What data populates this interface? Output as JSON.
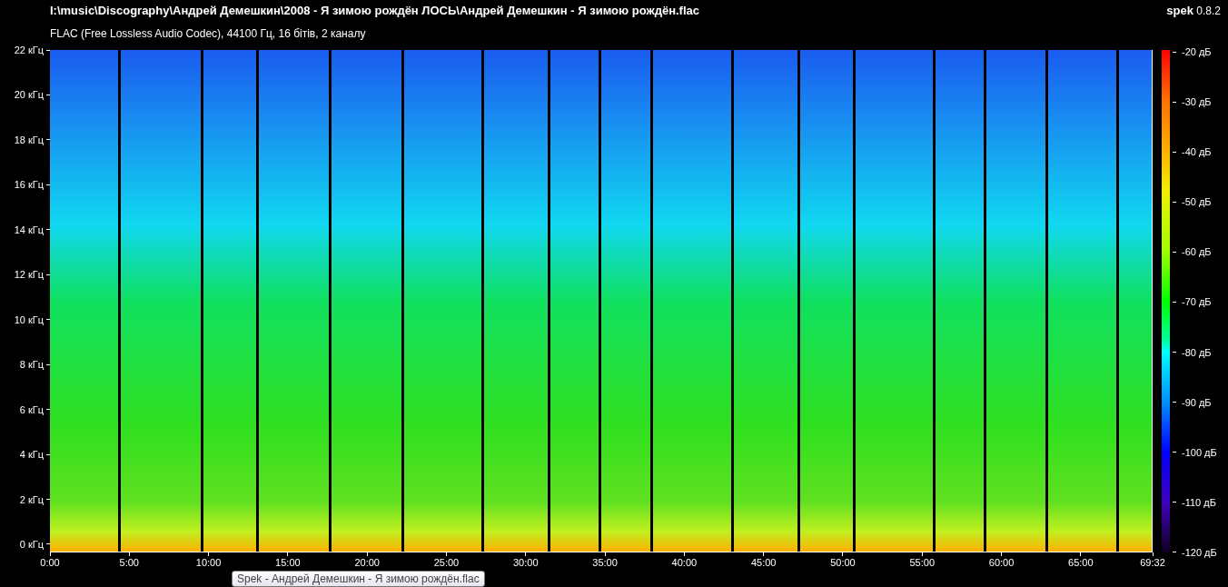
{
  "header": {
    "path": "I:\\music\\Discography\\Андрей Демешкин\\2008 - Я зимою рождён ЛОСЬ\\Андрей Демешкин - Я зимою рождён.flac",
    "format": "FLAC (Free Lossless Audio Codec), 44100 Гц, 16 бітів, 2 каналу",
    "app_name": "spek",
    "app_version": "0.8.2"
  },
  "frequency_axis": [
    "22 кГц",
    "20 кГц",
    "18 кГц",
    "16 кГц",
    "14 кГц",
    "12 кГц",
    "10 кГц",
    "8 кГц",
    "6 кГц",
    "4 кГц",
    "2 кГц",
    "0 кГц"
  ],
  "time_axis": [
    "0:00",
    "5:00",
    "10:00",
    "15:00",
    "20:00",
    "25:00",
    "30:00",
    "35:00",
    "40:00",
    "45:00",
    "50:00",
    "55:00",
    "60:00",
    "65:00",
    "69:32"
  ],
  "level_scale": [
    "-20 дБ",
    "-30 дБ",
    "-40 дБ",
    "-50 дБ",
    "-60 дБ",
    "-70 дБ",
    "-80 дБ",
    "-90 дБ",
    "-100 дБ",
    "-110 дБ",
    "-120 дБ"
  ],
  "tooltip": "Spek - Андрей Демешкин - Я зимою рождён.flac"
}
